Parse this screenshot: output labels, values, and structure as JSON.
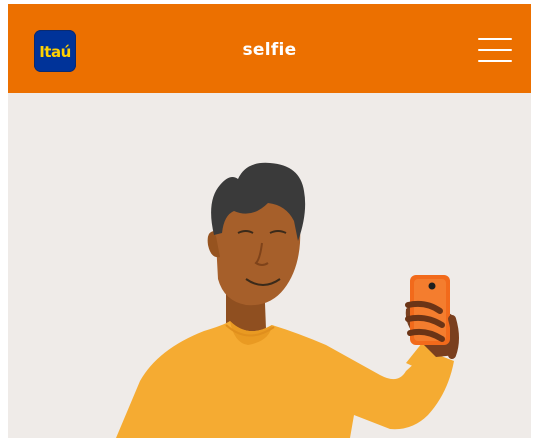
{
  "header": {
    "logo_text": "Itaú",
    "title": "selfie",
    "menu_icon": "hamburger-menu-icon"
  },
  "colors": {
    "brand_orange": "#ec7000",
    "logo_blue": "#003399",
    "logo_yellow": "#ffd100",
    "background": "#efebe8",
    "shirt": "#f5ab32",
    "skin": "#a65f2a",
    "hair": "#3a3a3a",
    "phone": "#f26a1b"
  },
  "illustration": {
    "subject": "person-taking-selfie-illustration"
  }
}
